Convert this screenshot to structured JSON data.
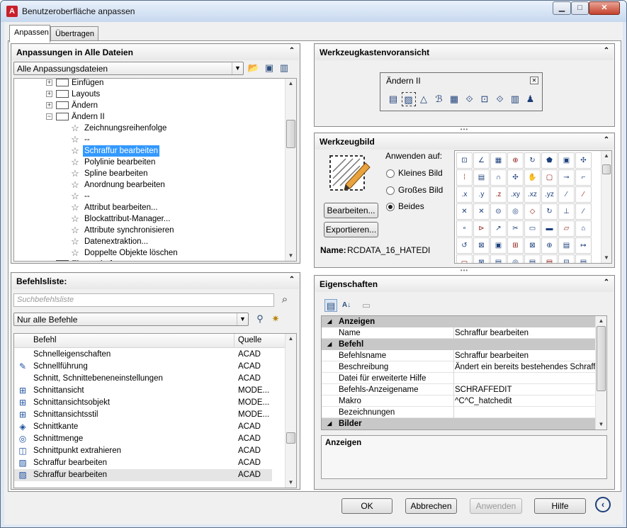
{
  "window": {
    "title": "Benutzeroberfläche anpassen",
    "icon": "A",
    "min": "▁",
    "max": "□",
    "close": "✕"
  },
  "tabs": [
    {
      "label": "Anpassen"
    },
    {
      "label": "Übertragen"
    }
  ],
  "customizations": {
    "header": "Anpassungen in Alle Dateien",
    "filter": "Alle Anpassungsdateien",
    "tree": [
      {
        "label": "Einfügen",
        "level": 1,
        "toggle": "+"
      },
      {
        "label": "Layouts",
        "level": 1,
        "toggle": "+"
      },
      {
        "label": "Ändern",
        "level": 1,
        "toggle": "+"
      },
      {
        "label": "Ändern II",
        "level": 1,
        "toggle": "−"
      },
      {
        "label": "Zeichnungsreihenfolge",
        "level": 2
      },
      {
        "label": "--",
        "level": 2
      },
      {
        "label": "Schraffur bearbeiten",
        "level": 2,
        "selected": true
      },
      {
        "label": "Polylinie bearbeiten",
        "level": 2
      },
      {
        "label": "Spline bearbeiten",
        "level": 2
      },
      {
        "label": "Anordnung bearbeiten",
        "level": 2
      },
      {
        "label": "--",
        "level": 2
      },
      {
        "label": "Attribut bearbeiten...",
        "level": 2
      },
      {
        "label": "Blockattribut-Manager...",
        "level": 2
      },
      {
        "label": "Attribute synchronisieren",
        "level": 2
      },
      {
        "label": "Datenextraktion...",
        "level": 2
      },
      {
        "label": "Doppelte Objekte löschen",
        "level": 2
      },
      {
        "label": "Eigenschaften",
        "level": 1,
        "toggle": "+"
      }
    ]
  },
  "commands": {
    "header": "Befehlsliste:",
    "search_placeholder": "Suchbefehlsliste",
    "filter": "Nur alle Befehle",
    "col_command": "Befehl",
    "col_source": "Quelle",
    "rows": [
      {
        "name": "Schnelleigenschaften",
        "source": "ACAD",
        "icon": ""
      },
      {
        "name": "Schnellführung",
        "source": "ACAD",
        "icon": "✎"
      },
      {
        "name": "Schnitt, Schnittebeneneinstellungen",
        "source": "ACAD",
        "icon": ""
      },
      {
        "name": "Schnittansicht",
        "source": "MODE...",
        "icon": "⊞"
      },
      {
        "name": "Schnittansichtsobjekt",
        "source": "MODE...",
        "icon": "⊞"
      },
      {
        "name": "Schnittansichtsstil",
        "source": "MODE...",
        "icon": "⊞"
      },
      {
        "name": "Schnittkante",
        "source": "ACAD",
        "icon": "◈"
      },
      {
        "name": "Schnittmenge",
        "source": "ACAD",
        "icon": "◎"
      },
      {
        "name": "Schnittpunkt extrahieren",
        "source": "ACAD",
        "icon": "◫"
      },
      {
        "name": "Schraffur bearbeiten",
        "source": "ACAD",
        "icon": "▨"
      },
      {
        "name": "Schraffur bearbeiten",
        "source": "ACAD",
        "icon": "▨",
        "selected": true
      }
    ]
  },
  "toolbar_preview": {
    "header": "Werkzeugkastenvoransicht",
    "toolbar_title": "Ändern II",
    "icons": [
      "▤",
      "▨",
      "△",
      "ℬ",
      "▦",
      "⟐",
      "⊡",
      "⟐",
      "▥",
      "♟"
    ]
  },
  "button_image": {
    "header": "Werkzeugbild",
    "apply_to": "Anwenden auf:",
    "radio_small": "Kleines Bild",
    "radio_large": "Großes Bild",
    "radio_both": "Beides",
    "edit": "Bearbeiten...",
    "export": "Exportieren...",
    "name_label": "Name:",
    "name_value": "RCDATA_16_HATEDI",
    "grid": [
      "⊡",
      "∠",
      "▦",
      "⊕",
      "↻",
      "⬟",
      "▣",
      "✣",
      "⁞",
      "▤",
      "∩",
      "✣",
      "✋",
      "▢",
      "⊸",
      "⌐",
      ".x",
      ".y",
      ".z",
      ".xy",
      ".xz",
      ".yz",
      "⁄",
      "⁄",
      "✕",
      "✕",
      "⊝",
      "◎",
      "◇",
      "↻",
      "⊥",
      "∕",
      "∘",
      "⊳",
      "↗",
      "✂",
      "▭",
      "▬",
      "▱",
      "⌂",
      "↺",
      "⊠",
      "▣",
      "⊞",
      "⊠",
      "⊕",
      "▤",
      "↦",
      "▭",
      "⊠",
      "▤",
      "◎",
      "▤",
      "▤",
      "⊟",
      "▤"
    ]
  },
  "properties": {
    "header": "Eigenschaften",
    "rows": [
      {
        "type": "cat",
        "key": "Anzeigen"
      },
      {
        "type": "row",
        "key": "Name",
        "value": "Schraffur bearbeiten"
      },
      {
        "type": "cat",
        "key": "Befehl"
      },
      {
        "type": "row",
        "key": "Befehlsname",
        "value": "Schraffur bearbeiten"
      },
      {
        "type": "row",
        "key": "Beschreibung",
        "value": "Ändert ein bereits bestehendes Schraffur"
      },
      {
        "type": "row",
        "key": "Datei für erweiterte Hilfe",
        "value": ""
      },
      {
        "type": "row",
        "key": "Befehls-Anzeigename",
        "value": "SCHRAFFEDIT"
      },
      {
        "type": "row",
        "key": "Makro",
        "value": "^C^C_hatchedit"
      },
      {
        "type": "row",
        "key": "Bezeichnungen",
        "value": ""
      },
      {
        "type": "cat",
        "key": "Bilder"
      }
    ],
    "description_title": "Anzeigen"
  },
  "footer": {
    "ok": "OK",
    "cancel": "Abbrechen",
    "apply": "Anwenden",
    "help": "Hilfe"
  }
}
